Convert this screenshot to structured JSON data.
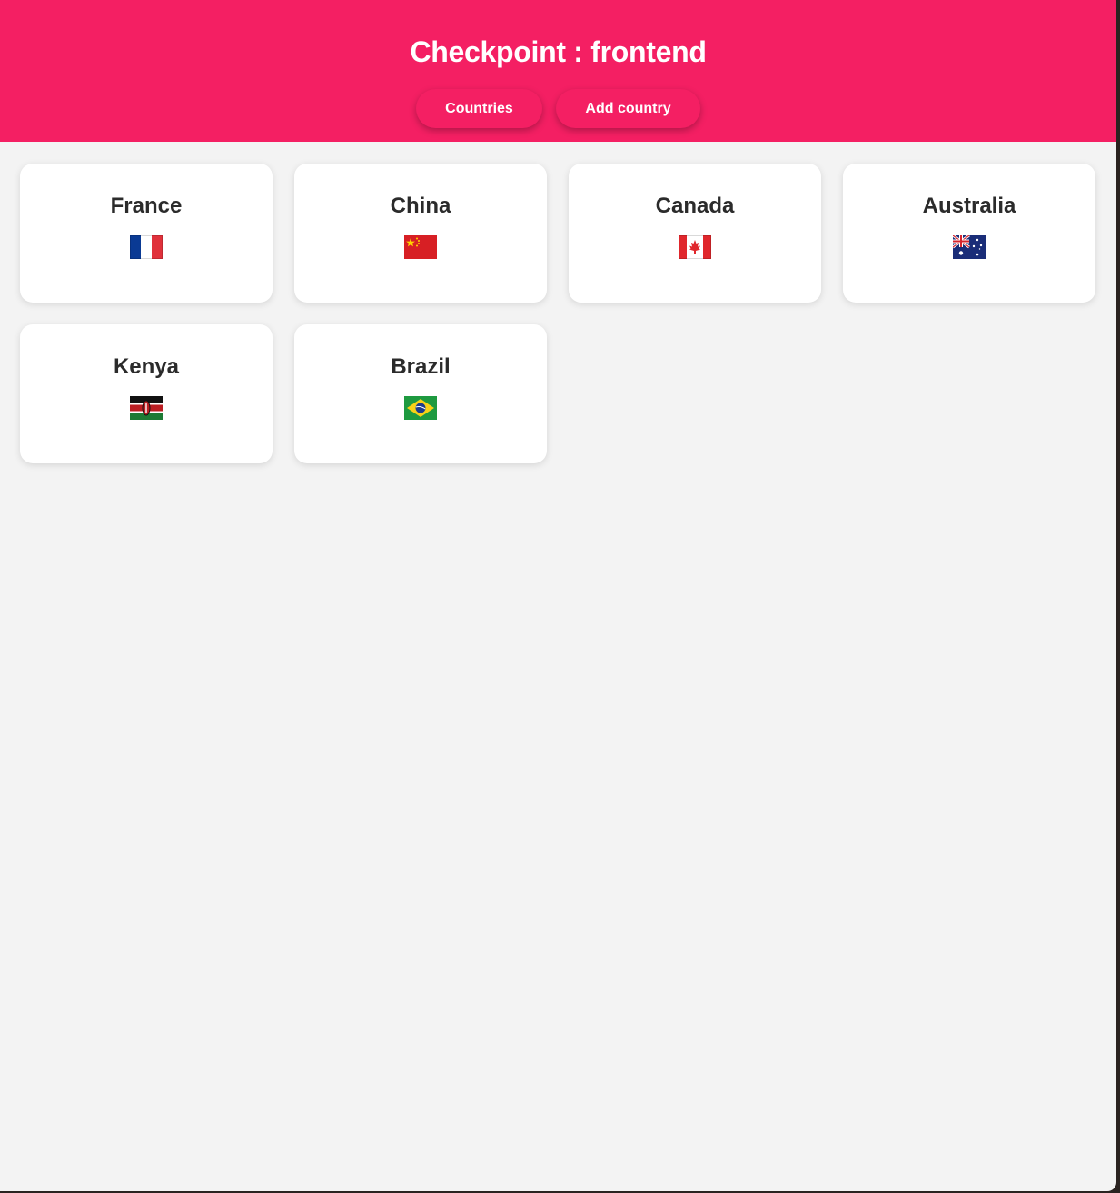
{
  "header": {
    "title": "Checkpoint : frontend",
    "nav": {
      "countries_label": "Countries",
      "add_country_label": "Add country"
    },
    "accent_color": "#f41f63"
  },
  "countries": [
    {
      "name": "France",
      "flag": "flag-france-icon"
    },
    {
      "name": "China",
      "flag": "flag-china-icon"
    },
    {
      "name": "Canada",
      "flag": "flag-canada-icon"
    },
    {
      "name": "Australia",
      "flag": "flag-australia-icon"
    },
    {
      "name": "Kenya",
      "flag": "flag-kenya-icon"
    },
    {
      "name": "Brazil",
      "flag": "flag-brazil-icon"
    }
  ]
}
